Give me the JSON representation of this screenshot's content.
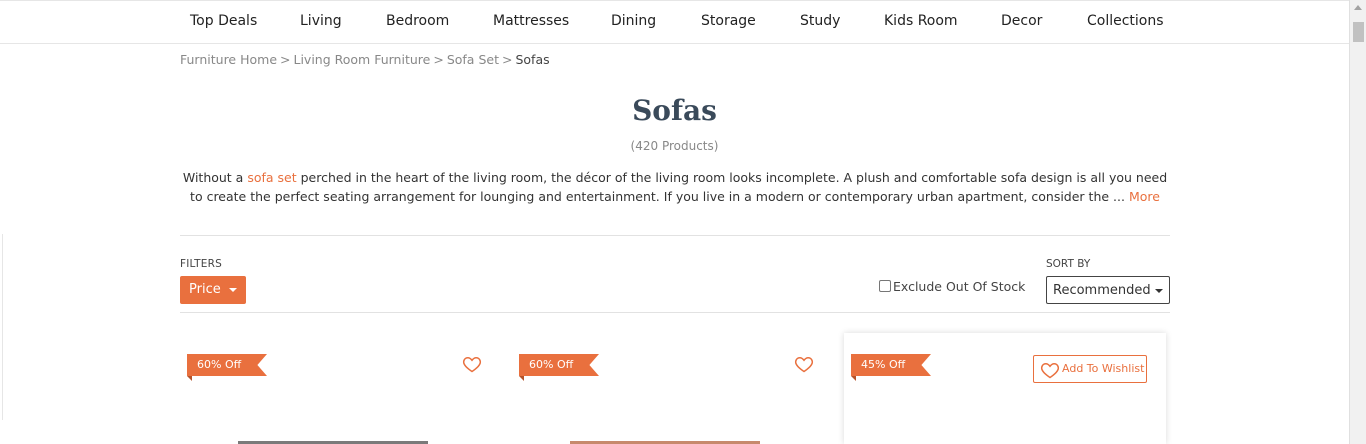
{
  "nav": {
    "items": [
      "Top Deals",
      "Living",
      "Bedroom",
      "Mattresses",
      "Dining",
      "Storage",
      "Study",
      "Kids Room",
      "Decor",
      "Collections"
    ]
  },
  "breadcrumb": {
    "items": [
      "Furniture Home",
      "Living Room Furniture",
      "Sofa Set"
    ],
    "separator": ">",
    "current": "Sofas"
  },
  "page": {
    "title": "Sofas",
    "count": "(420 Products)"
  },
  "description": {
    "prefix": "Without a ",
    "link": "sofa set",
    "text": " perched in the heart of the living room, the décor of the living room looks incomplete. A plush and comfortable sofa design is all you need to create the perfect seating arrangement for lounging and entertainment. If you live in a modern or contemporary urban apartment, consider the ... ",
    "more": "More"
  },
  "filters": {
    "label": "FILTERS",
    "price_label": "Price",
    "exclude_label": "Exclude Out Of Stock",
    "exclude_checked": false
  },
  "sort": {
    "label": "SORT BY",
    "selected": "Recommended"
  },
  "products": [
    {
      "discount": "60% Off",
      "wishlist_label": ""
    },
    {
      "discount": "60% Off",
      "wishlist_label": ""
    },
    {
      "discount": "45% Off",
      "wishlist_label": "Add To Wishlist"
    }
  ],
  "colors": {
    "accent": "#e9703e",
    "title": "#3a4a5a"
  },
  "icons": {
    "heart": "heart-icon",
    "dropdown": "caret-down-icon"
  }
}
